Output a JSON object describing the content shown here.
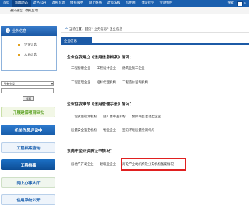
{
  "nav": {
    "items": [
      "首页",
      "新闻动态",
      "政务公开",
      "政民互动",
      "便民服务",
      "网上办事",
      "政策法规",
      "信用网",
      "建设行业",
      "专题专栏",
      "搜索"
    ]
  },
  "subbar": {
    "links": [
      "通知通告",
      "政民互动"
    ]
  },
  "sidebar": {
    "title": "业务信息",
    "items": [
      "企业信息",
      "人员信息"
    ],
    "select_value": "所有分类",
    "go_label": "搜索",
    "banners": [
      "开展建设项目审批",
      "机关作风评议中",
      "工程档案查询",
      "工程档案",
      "网上办事大厅",
      "住建系统公开"
    ]
  },
  "main": {
    "breadcrumb": [
      "当前位置：",
      "首页",
      ">",
      "业务信息",
      ">",
      "企业信息"
    ],
    "tab_label": "企业信息",
    "sections": [
      {
        "title": "企业在我建立《信用信息档案》情况：",
        "rows": [
          [
            "工程勘察企业",
            "工程设计企业",
            "建筑业施工企业"
          ],
          [
            "工程监理企业",
            "招标代理机构",
            "工程造价咨询机构"
          ]
        ]
      },
      {
        "title": "企业在我申领《信用管理手册》情况：",
        "rows": [
          [
            "工程质量检测机构",
            "施工图审查机构",
            "预拌商品混凝土企业"
          ],
          [
            "质量安全鉴定机构",
            "物业企业",
            "室内环境质量检测机构"
          ]
        ]
      },
      {
        "title": "东莞市企业资质证书情况：",
        "rows": [
          [
            "房地产开发企业",
            "建筑业企业",
            "商砼产业站机构及分支机构备案情况"
          ]
        ]
      }
    ]
  }
}
